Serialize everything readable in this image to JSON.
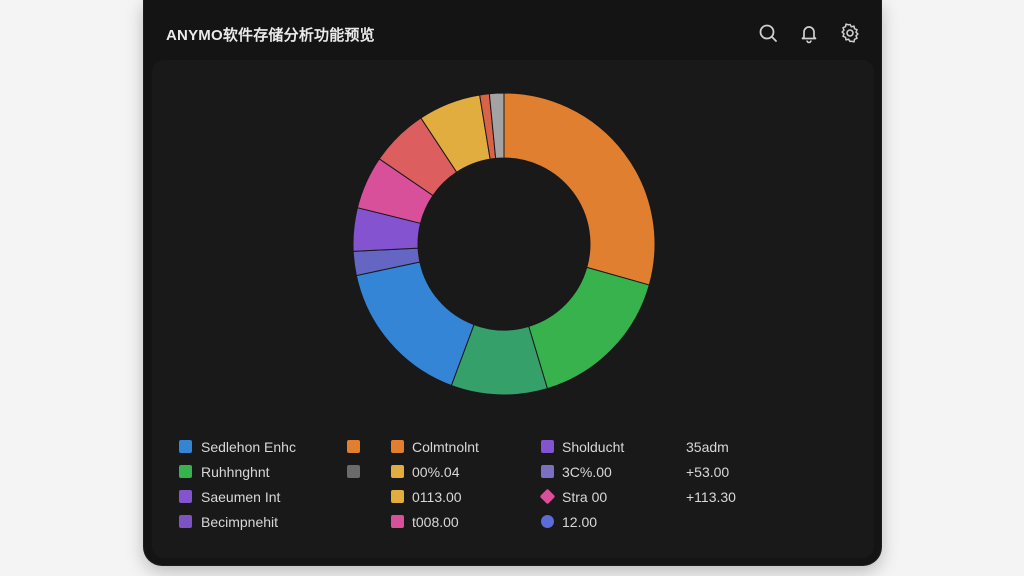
{
  "window": {
    "title": "ANYMO软件存储分析功能预览"
  },
  "toolbar": {
    "icons": [
      "search-icon",
      "bell-icon",
      "gear-icon"
    ]
  },
  "chart_data": {
    "type": "pie",
    "donut": true,
    "title": "",
    "series": [
      {
        "value": 28.5,
        "color": "#e07f30"
      },
      {
        "value": 15.5,
        "color": "#37b24d"
      },
      {
        "value": 10.0,
        "color": "#36a06a"
      },
      {
        "value": 15.5,
        "color": "#3585d6"
      },
      {
        "value": 2.5,
        "color": "#6565c4"
      },
      {
        "value": 4.5,
        "color": "#8453cf"
      },
      {
        "value": 5.5,
        "color": "#d8509a"
      },
      {
        "value": 6.0,
        "color": "#dc5e5e"
      },
      {
        "value": 6.5,
        "color": "#e0ad3e"
      },
      {
        "value": 1.0,
        "color": "#da6248"
      },
      {
        "value": 1.5,
        "color": "#a3a3a3"
      }
    ]
  },
  "legend": {
    "col1": [
      {
        "label": "Sedlehon Enhc",
        "color": "#3585d6"
      },
      {
        "label": "Ruhhnghnt",
        "color": "#37b24d"
      },
      {
        "label": "Saeumen Int",
        "color": "#8453cf"
      },
      {
        "label": "Becimpnehit",
        "color": "#7d52c2"
      }
    ],
    "col2": [
      {
        "label": "",
        "color": "#e07f30"
      },
      {
        "label": "",
        "color": "#6b6b6b"
      }
    ],
    "col3": [
      {
        "label": "Colmtnolnt",
        "color": "#e07f30"
      },
      {
        "label": "00%.04",
        "color": "#e0ad3e"
      },
      {
        "label": "0113.00",
        "color": "#e0ad3e"
      },
      {
        "label": "t008.00",
        "color": "#d8509a"
      }
    ],
    "col4": [
      {
        "label": "Sholducht",
        "color": "#8453cf"
      },
      {
        "label": "3C%.00",
        "color": "#7b6fbf"
      },
      {
        "label": "Stra 00",
        "color": "#d8509a"
      },
      {
        "label": "12.00",
        "color": "#5d6bd6"
      }
    ],
    "col5": [
      {
        "label": "35adm"
      },
      {
        "label": "+53.00"
      },
      {
        "label": "+113.30"
      }
    ]
  }
}
